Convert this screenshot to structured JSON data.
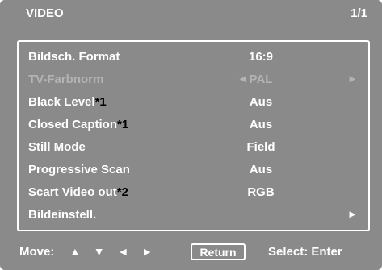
{
  "header": {
    "title": "VIDEO",
    "page": "1/1"
  },
  "menu": [
    {
      "label": "Bildsch. Format",
      "note": "",
      "value": "16:9"
    },
    {
      "label": "TV-Farbnorm",
      "note": "",
      "value": "PAL",
      "left_arrow": "◄",
      "right_arrow": "►",
      "disabled": true
    },
    {
      "label": "Black Level",
      "note": "*1",
      "value": "Aus"
    },
    {
      "label": "Closed Caption",
      "note": "*1",
      "value": "Aus"
    },
    {
      "label": "Still Mode",
      "note": "",
      "value": "Field"
    },
    {
      "label": "Progressive Scan",
      "note": "",
      "value": "Aus"
    },
    {
      "label": "Scart Video out",
      "note": "*2",
      "value": "RGB"
    },
    {
      "label": "Bildeinstell.",
      "note": "",
      "value": "",
      "right_arrow": "►"
    }
  ],
  "footer": {
    "move_label": "Move:",
    "nav_arrows": "▲ ▼ ◄ ►",
    "return_label": "Return",
    "select_label": "Select: Enter"
  },
  "colors": {
    "background": "#8a8a8a",
    "text": "#ffffff",
    "disabled_text": "#b3b3b3",
    "note_text": "#000000"
  }
}
